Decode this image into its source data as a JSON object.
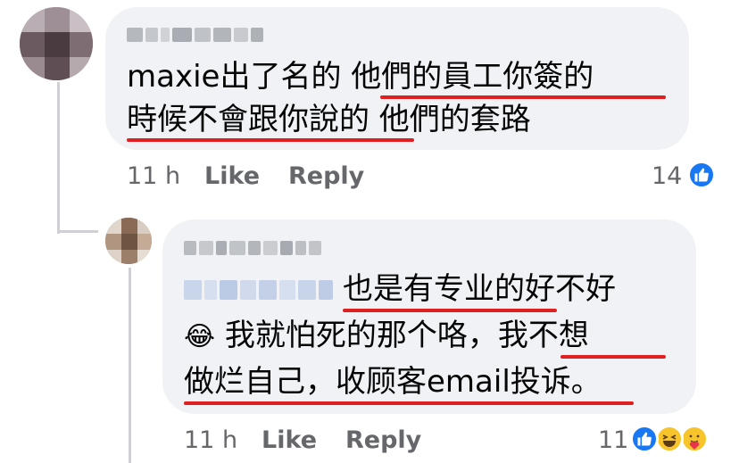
{
  "comments": [
    {
      "author_blurred": "JC Chik",
      "lines": [
        [
          "maxie出了名的 ",
          "他們的員工你簽的"
        ],
        [
          "時候不會跟你說的",
          " 他們的套路"
        ]
      ],
      "time": "11 h",
      "like_label": "Like",
      "reply_label": "Reply",
      "reaction_count": "14",
      "reactions": [
        "like-reaction-icon"
      ]
    },
    {
      "author_blurred": "Mickey Chi",
      "mention_blurred": "JC Chik",
      "lines": [
        [
          "也是有专业的",
          "好不好"
        ],
        [
          "😂",
          " 我就怕死的那个咯，",
          "我不想"
        ],
        [
          "做烂自己，收顾客email投诉",
          "。"
        ]
      ],
      "time": "11 h",
      "like_label": "Like",
      "reply_label": "Reply",
      "reaction_count": "11",
      "reactions": [
        "like-reaction-icon",
        "haha-reaction-icon",
        "care-reaction-icon"
      ]
    }
  ],
  "colors": {
    "bubble": "#f0f2f5",
    "underline": "#e02020",
    "meta": "#65676b",
    "like_blue": "#1877f2"
  }
}
